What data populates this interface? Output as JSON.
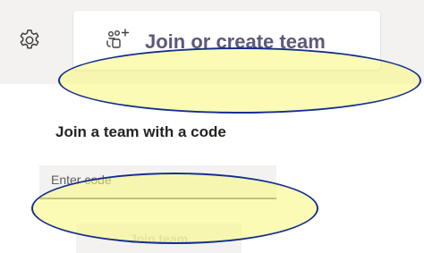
{
  "header": {
    "settings_icon": "gear-icon",
    "join_card": {
      "icon": "teams-add-icon",
      "label": "Join or create team"
    }
  },
  "join_code": {
    "heading": "Join a team with a code",
    "input": {
      "placeholder": "Enter code",
      "value": ""
    },
    "button_label": "Join team",
    "button_disabled": true
  },
  "annotations": {
    "highlight_color": "#f8f882",
    "outline_color": "#142e8f"
  }
}
